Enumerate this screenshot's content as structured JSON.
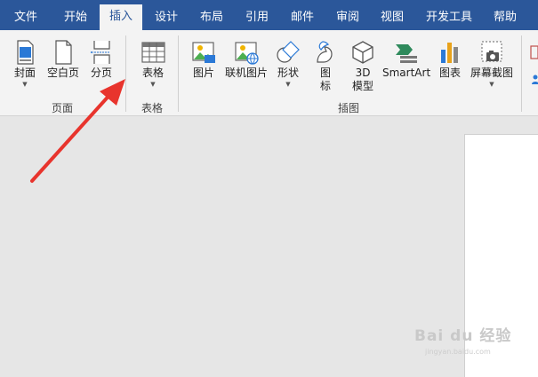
{
  "tabs": [
    {
      "label": "文件"
    },
    {
      "label": "开始"
    },
    {
      "label": "插入"
    },
    {
      "label": "设计"
    },
    {
      "label": "布局"
    },
    {
      "label": "引用"
    },
    {
      "label": "邮件"
    },
    {
      "label": "审阅"
    },
    {
      "label": "视图"
    },
    {
      "label": "开发工具"
    },
    {
      "label": "帮助"
    }
  ],
  "active_tab": "插入",
  "ribbon": {
    "pages_group": {
      "label": "页面",
      "cover": "封面",
      "blank_page": "空白页",
      "page_break": "分页"
    },
    "table_group": {
      "label": "表格",
      "table": "表格"
    },
    "illustrations_group": {
      "label": "插图",
      "pictures": "图片",
      "online_pictures": "联机图片",
      "shapes": "形状",
      "icons_line1": "图",
      "icons_line2": "标",
      "model3d_line1": "3D",
      "model3d_line2": "模型",
      "smartart": "SmartArt",
      "chart": "图表",
      "screenshot": "屏幕截图"
    }
  },
  "watermark": {
    "brand": "Bai du 经验",
    "url": "jingyan.baidu.com"
  },
  "colors": {
    "accent": "#2b579a",
    "arrow": "#e8342d"
  }
}
